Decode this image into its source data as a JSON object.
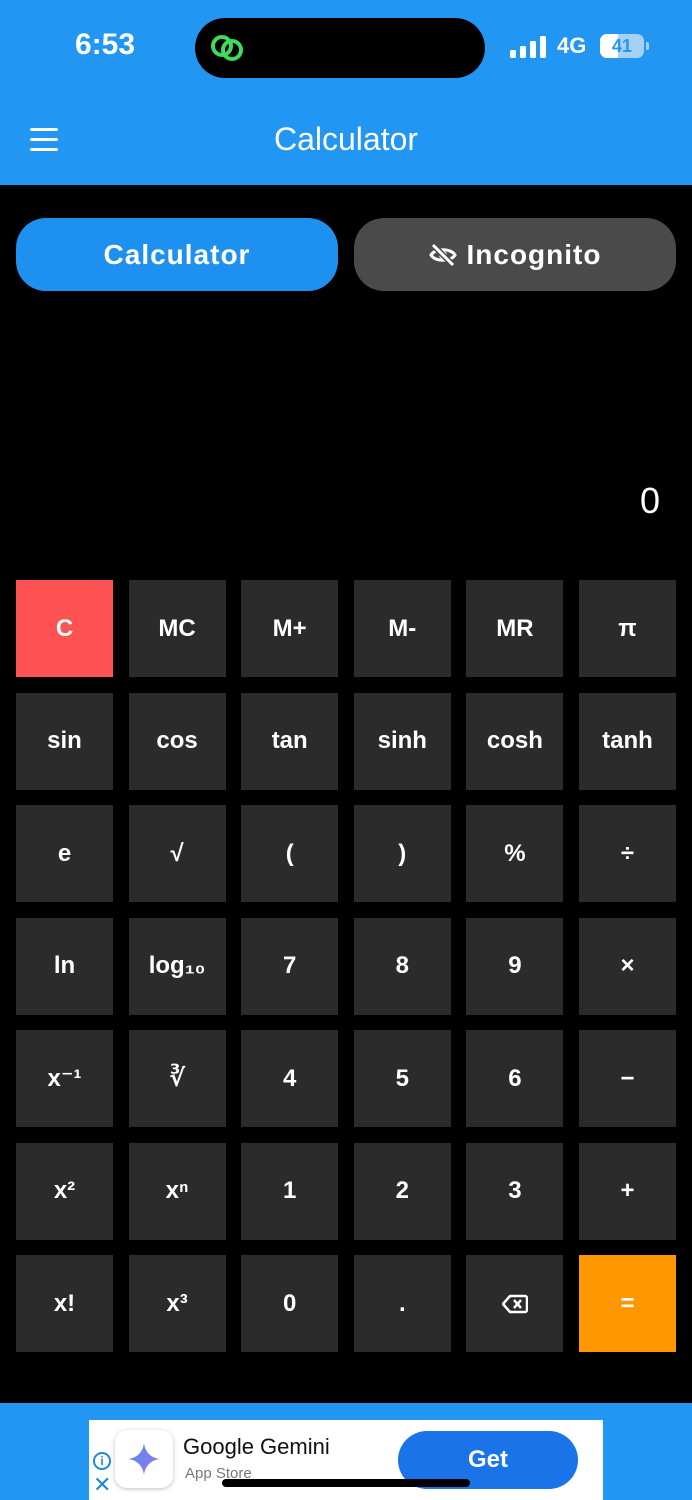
{
  "status_bar": {
    "time": "6:53",
    "network": "4G",
    "battery": "41",
    "battery_level": 0.41
  },
  "app_bar": {
    "title": "Calculator",
    "menu_icon": "hamburger-menu-icon"
  },
  "tabs": {
    "calculator_label": "Calculator",
    "incognito_label": "Incognito",
    "incognito_icon": "eye-off-icon"
  },
  "display": {
    "value": "0"
  },
  "keys": [
    "C",
    "MC",
    "M+",
    "M-",
    "MR",
    "π",
    "sin",
    "cos",
    "tan",
    "sinh",
    "cosh",
    "tanh",
    "e",
    "√",
    "(",
    ")",
    "%",
    "÷",
    "ln",
    "log₁₀",
    "7",
    "8",
    "9",
    "×",
    "x⁻¹",
    "∛",
    "4",
    "5",
    "6",
    "−",
    "x²",
    "xⁿ",
    "1",
    "2",
    "3",
    "+",
    "x!",
    "x³",
    "0",
    ".",
    "⌫",
    "="
  ],
  "ad": {
    "title": "Google Gemini",
    "subtitle": "App Store",
    "cta": "Get"
  },
  "colors": {
    "primary": "#2196F3",
    "clear_key": "#FF5252",
    "equals_key": "#FF9800",
    "key_bg": "#2b2b2b"
  }
}
